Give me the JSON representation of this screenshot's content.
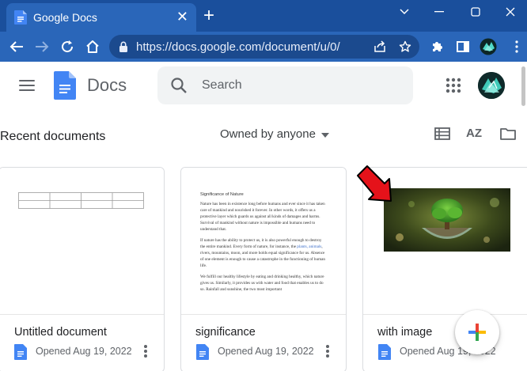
{
  "browser": {
    "tab_title": "Google Docs",
    "address_url": "https://docs.google.com/document/u/0/"
  },
  "docs": {
    "app_name": "Docs",
    "search_placeholder": "Search"
  },
  "section": {
    "title": "Recent documents",
    "owner_filter": "Owned by anyone",
    "sort_label": "AZ"
  },
  "documents": [
    {
      "title": "Untitled document",
      "opened": "Opened Aug 19, 2022"
    },
    {
      "title": "significance",
      "opened": "Opened Aug 19, 2022"
    },
    {
      "title": "with image",
      "opened": "Opened Aug 19, 2022"
    }
  ],
  "significance_preview": {
    "heading": "Significance of Nature",
    "para1": "Nature has been in existence long before humans and ever since it has taken care of mankind and nourished it forever. In other words, it offers us a protective layer which guards us against all kinds of damages and harms. Survival of mankind without nature is impossible and humans need to understand that.",
    "para2_a": "If nature has the ability to protect us, it is also powerful enough to destroy the entire mankind. Every form of nature, for instance, the ",
    "para2_link": "plants, animals",
    "para2_b": ", rivers, mountains, moon, and more holds equal significance for us. Absence of one element is enough to cause a catastrophe in the functioning of human life.",
    "para3": "We fulfill our healthy lifestyle by eating and drinking healthy, which nature gives us. Similarly, it provides us with water and food that enables us to do so. Rainfall and sunshine, the two most important"
  },
  "colors": {
    "chrome_frame": "#1a4f9c",
    "chrome_toolbar": "#2a66b9",
    "docs_blue": "#4285f4",
    "arrow_red": "#e5121a"
  }
}
